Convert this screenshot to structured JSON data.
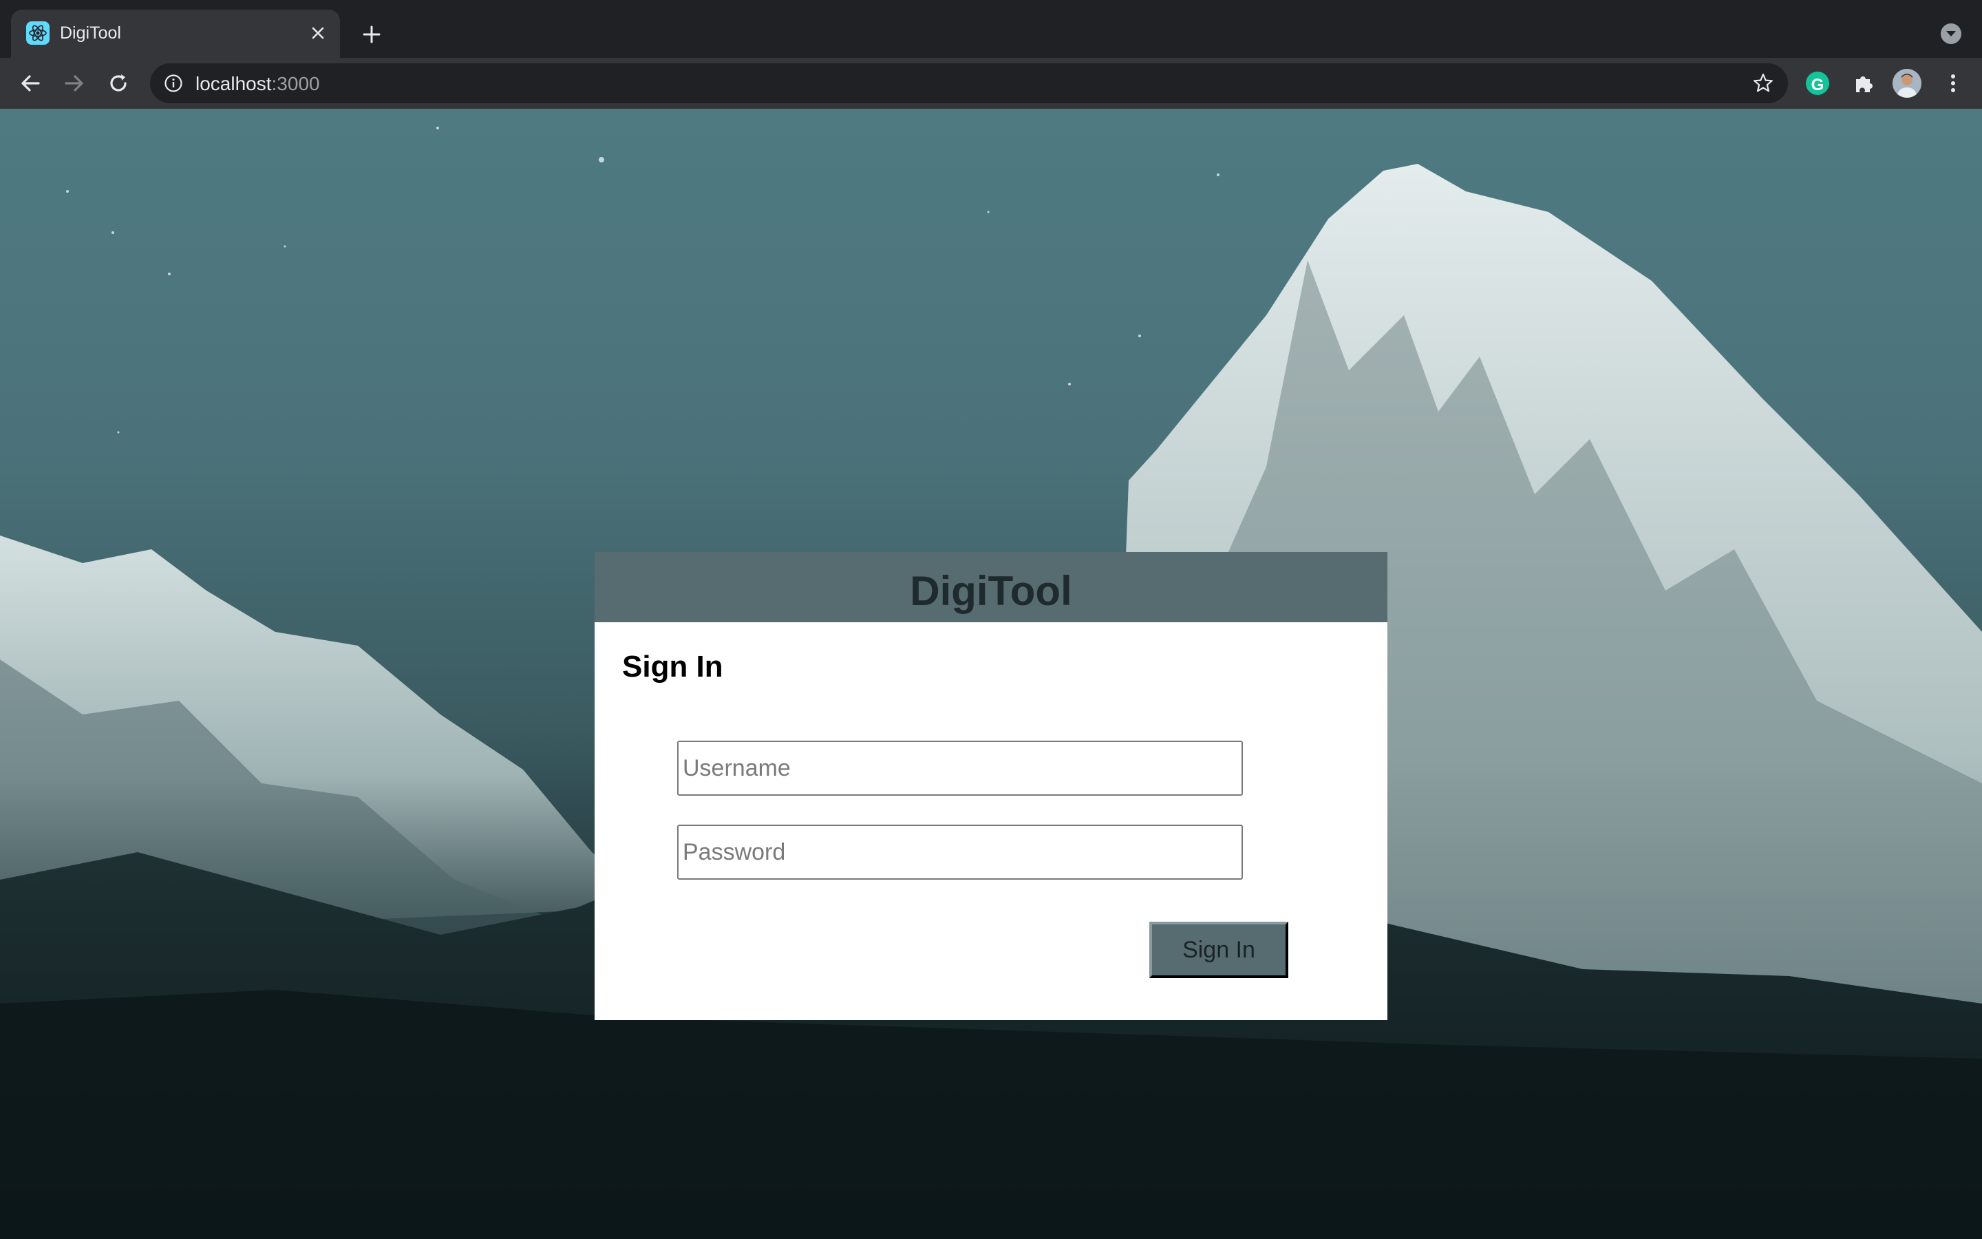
{
  "browser": {
    "tab": {
      "title": "DigiTool",
      "favicon": "react-logo-icon"
    },
    "address": {
      "host": "localhost",
      "port": ":3000"
    },
    "extensions": {
      "grammarly_letter": "G"
    }
  },
  "colors": {
    "header_bg": "#576c71",
    "button_bg": "#576c71",
    "card_bg": "#ffffff"
  },
  "login": {
    "brand": "DigiTool",
    "heading": "Sign In",
    "username_placeholder": "Username",
    "password_placeholder": "Password",
    "submit_label": "Sign In"
  }
}
